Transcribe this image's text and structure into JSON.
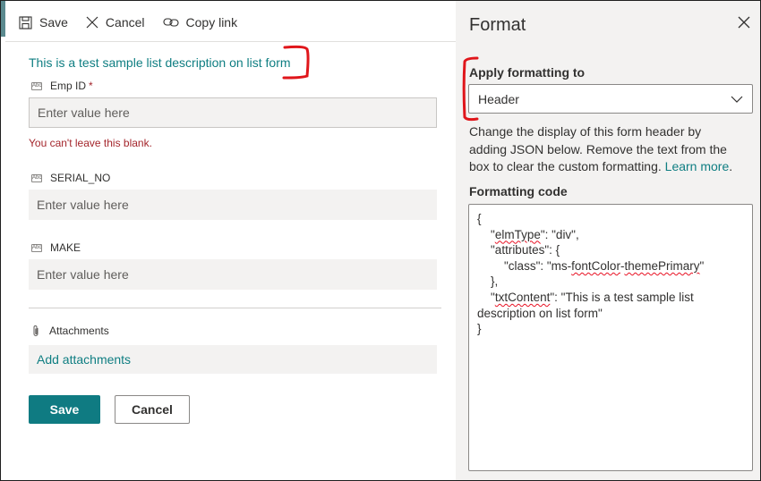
{
  "toolbar": {
    "save_label": "Save",
    "cancel_label": "Cancel",
    "copy_link_label": "Copy link"
  },
  "form": {
    "description": "This is a test sample list description on list form",
    "fields": [
      {
        "label": "Emp ID",
        "required": "*",
        "placeholder": "Enter value here",
        "error": "You can't leave this blank."
      },
      {
        "label": "SERIAL_NO",
        "placeholder": "Enter value here"
      },
      {
        "label": "MAKE",
        "placeholder": "Enter value here"
      }
    ],
    "field_type_icon_text": "Abc",
    "attachments_label": "Attachments",
    "add_attachments_label": "Add attachments",
    "save_button": "Save",
    "cancel_button": "Cancel"
  },
  "format_panel": {
    "title": "Format",
    "apply_label": "Apply formatting to",
    "apply_value": "Header",
    "help_text": "Change the display of this form header by adding JSON below. Remove the text from the box to clear the custom formatting.",
    "learn_more": "Learn more",
    "code_label": "Formatting code",
    "code": {
      "l1": "{",
      "l2a": "    \"",
      "l2b": "elmType",
      "l2c": "\": \"div\",",
      "l3": "    \"attributes\": {",
      "l4a": "        \"class\": \"ms-",
      "l4b": "fontColor",
      "l4c": "-",
      "l4d": "themePrimary",
      "l4e": "\"",
      "l5": "    },",
      "l6a": "    \"",
      "l6b": "txtContent",
      "l6c": "\": \"This is a test sample list description on list form\"",
      "l7": "}"
    }
  },
  "colors": {
    "accent": "#0f7b82",
    "link": "#0f7e82",
    "error": "#a4262c",
    "annotation": "#e0161b"
  }
}
